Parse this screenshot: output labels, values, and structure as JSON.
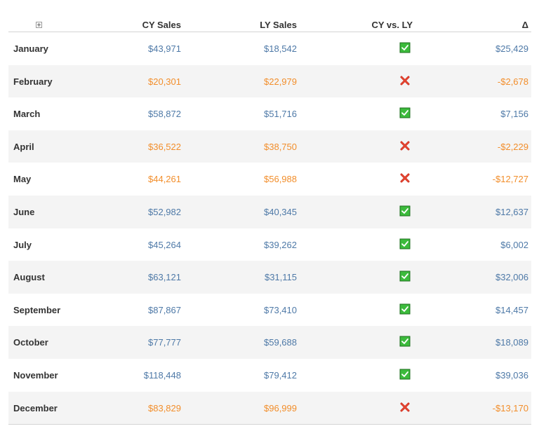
{
  "header": {
    "cy_sales": "CY Sales",
    "ly_sales": "LY Sales",
    "cy_vs_ly": "CY vs. LY",
    "delta": "Δ"
  },
  "colors": {
    "positive": "#4e79a7",
    "negative": "#f28e2b",
    "check_fill": "#3cbb3c",
    "cross": "#cc2a1a"
  },
  "rows": [
    {
      "month": "January",
      "cy": "$43,971",
      "ly": "$18,542",
      "status": "check-icon",
      "delta": "$25,429"
    },
    {
      "month": "February",
      "cy": "$20,301",
      "ly": "$22,979",
      "status": "cross-icon",
      "delta": "-$2,678"
    },
    {
      "month": "March",
      "cy": "$58,872",
      "ly": "$51,716",
      "status": "check-icon",
      "delta": "$7,156"
    },
    {
      "month": "April",
      "cy": "$36,522",
      "ly": "$38,750",
      "status": "cross-icon",
      "delta": "-$2,229"
    },
    {
      "month": "May",
      "cy": "$44,261",
      "ly": "$56,988",
      "status": "cross-icon",
      "delta": "-$12,727"
    },
    {
      "month": "June",
      "cy": "$52,982",
      "ly": "$40,345",
      "status": "check-icon",
      "delta": "$12,637"
    },
    {
      "month": "July",
      "cy": "$45,264",
      "ly": "$39,262",
      "status": "check-icon",
      "delta": "$6,002"
    },
    {
      "month": "August",
      "cy": "$63,121",
      "ly": "$31,115",
      "status": "check-icon",
      "delta": "$32,006"
    },
    {
      "month": "September",
      "cy": "$87,867",
      "ly": "$73,410",
      "status": "check-icon",
      "delta": "$14,457"
    },
    {
      "month": "October",
      "cy": "$77,777",
      "ly": "$59,688",
      "status": "check-icon",
      "delta": "$18,089"
    },
    {
      "month": "November",
      "cy": "$118,448",
      "ly": "$79,412",
      "status": "check-icon",
      "delta": "$39,036"
    },
    {
      "month": "December",
      "cy": "$83,829",
      "ly": "$96,999",
      "status": "cross-icon",
      "delta": "-$13,170"
    }
  ]
}
